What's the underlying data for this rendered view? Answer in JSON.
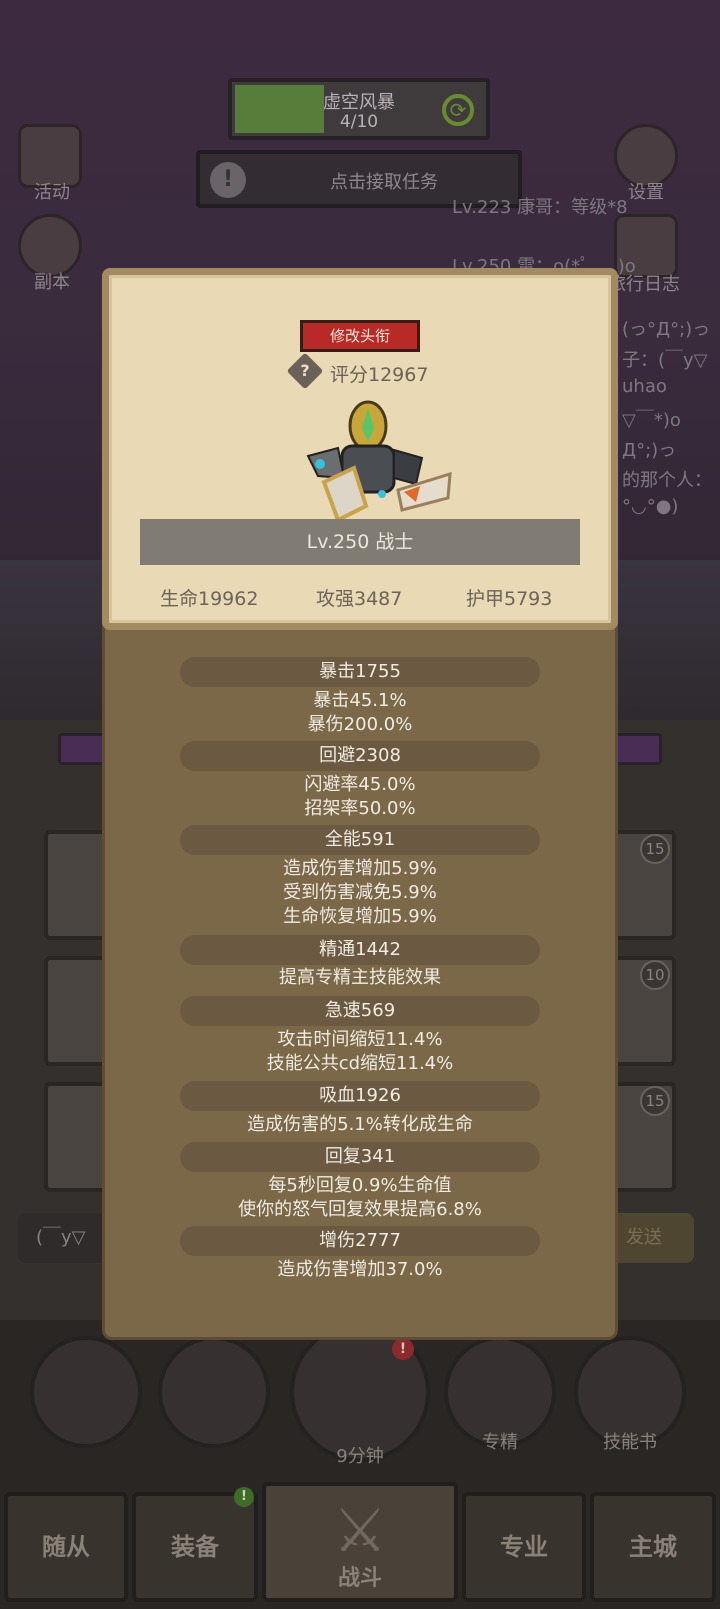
{
  "background": {
    "quest_title": "虚空风暴",
    "quest_progress": "4/10",
    "progress_fraction": 0.36,
    "task_label": "点击接取任务",
    "left_icons": [
      "活动",
      "副本"
    ],
    "right_icons": [
      "设置",
      "旅行日志"
    ],
    "chat_lines": [
      "Lv.223 康哥：等级*8",
      "Lv.250 雷：o(*ﾟ ... )o",
      "(っ°Д°;)っ",
      "子：(￣y▽",
      "uhao",
      "▽￣*)o",
      "Д°;)っ",
      "的那个人：",
      "°◡°●)"
    ],
    "grid_badges": [
      "15",
      "10",
      "15"
    ],
    "chat_placeholder": "(￣y▽",
    "send_label": "发送"
  },
  "actions": {
    "timer": "9分钟",
    "specialize": "专精",
    "skill_book": "技能书",
    "alert_mark": "!"
  },
  "tabs": [
    "随从",
    "装备",
    "战斗",
    "专业",
    "主城"
  ],
  "equip_badge": "!",
  "profile": {
    "edit_title_label": "修改头衔",
    "score": "评分12967",
    "level_class": "Lv.250 战士",
    "hp": "生命19962",
    "attack": "攻强3487",
    "armor": "护甲5793"
  },
  "stats": {
    "crit_header": "暴击1755",
    "crit_rate": "暴击45.1%",
    "crit_dmg": "暴伤200.0%",
    "dodge_header": "回避2308",
    "dodge_rate": "闪避率45.0%",
    "parry_rate": "招架率50.0%",
    "versa_header": "全能591",
    "versa_dmg": "造成伤害增加5.9%",
    "versa_red": "受到伤害减免5.9%",
    "versa_heal": "生命恢复增加5.9%",
    "mastery_header": "精通1442",
    "mastery_desc": "提高专精主技能效果",
    "haste_header": "急速569",
    "haste_atk": "攻击时间缩短11.4%",
    "haste_cd": "技能公共cd缩短11.4%",
    "leech_header": "吸血1926",
    "leech_desc": "造成伤害的5.1%转化成生命",
    "regen_header": "回复341",
    "regen_hp": "每5秒回复0.9%生命值",
    "regen_rage": "使你的怒气回复效果提高6.8%",
    "dmgup_header": "增伤2777",
    "dmgup_desc": "造成伤害增加37.0%"
  }
}
